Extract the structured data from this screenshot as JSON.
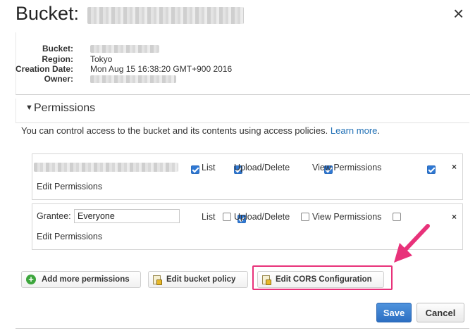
{
  "header": {
    "title": "Bucket:",
    "close_icon": "×"
  },
  "properties": [
    {
      "label": "Bucket:",
      "value": ""
    },
    {
      "label": "Region:",
      "value": "Tokyo"
    },
    {
      "label": "Creation Date:",
      "value": "Mon Aug 15 16:38:20 GMT+900 2016"
    },
    {
      "label": "Owner:",
      "value": ""
    }
  ],
  "permissions": {
    "section_title": "Permissions",
    "description": "You can control access to the bucket and its contents using access policies.",
    "learn_more": "Learn more",
    "description_end": ".",
    "grants": [
      {
        "grantee": "",
        "list": {
          "label": "List",
          "checked": true
        },
        "upload_delete": {
          "label": "Upload/Delete",
          "checked": true
        },
        "view_permissions": {
          "label": "View Permissions",
          "checked": true
        },
        "edit_permissions": {
          "label": "Edit Permissions",
          "checked": true
        },
        "remove": "×"
      },
      {
        "grantee_label": "Grantee:",
        "grantee": "Everyone",
        "list": {
          "label": "List",
          "checked": true
        },
        "upload_delete": {
          "label": "Upload/Delete",
          "checked": false
        },
        "view_permissions": {
          "label": "View Permissions",
          "checked": false
        },
        "edit_permissions": {
          "label": "Edit Permissions",
          "checked": false
        },
        "remove": "×"
      }
    ]
  },
  "actions": {
    "add_permissions": "Add more permissions",
    "edit_bucket_policy": "Edit bucket policy",
    "edit_cors": "Edit CORS Configuration"
  },
  "footer": {
    "save": "Save",
    "cancel": "Cancel"
  },
  "colors": {
    "highlight": "#e8327a",
    "primary": "#2f78d3",
    "link": "#1f6fb5"
  }
}
